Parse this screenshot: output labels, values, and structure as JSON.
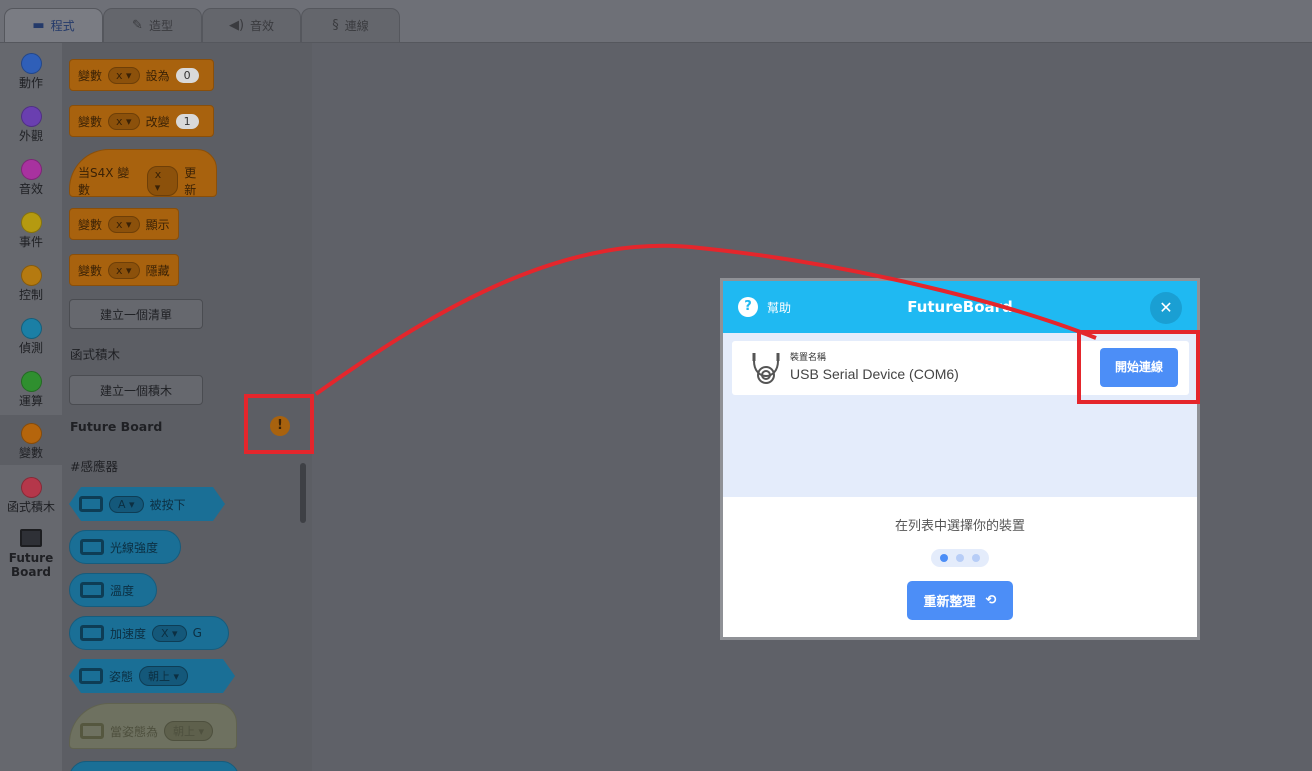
{
  "tabs": [
    {
      "label": "程式",
      "icon": "code-icon",
      "active": true
    },
    {
      "label": "造型",
      "icon": "brush-icon",
      "active": false
    },
    {
      "label": "音效",
      "icon": "speaker-icon",
      "active": false
    },
    {
      "label": "連線",
      "icon": "connection-icon",
      "active": false
    }
  ],
  "categories": [
    {
      "label": "動作",
      "color": "#2f5fb8"
    },
    {
      "label": "外觀",
      "color": "#6a3fb0"
    },
    {
      "label": "音效",
      "color": "#a8329f"
    },
    {
      "label": "事件",
      "color": "#b59a10"
    },
    {
      "label": "控制",
      "color": "#b57a10"
    },
    {
      "label": "偵測",
      "color": "#1b7fa5"
    },
    {
      "label": "運算",
      "color": "#2f8f2f"
    },
    {
      "label": "變數",
      "color": "#b5650c"
    },
    {
      "label": "函式積木",
      "color": "#b5374a"
    },
    {
      "label": "Future\nBoard",
      "color": "#1c1d20"
    }
  ],
  "palette": {
    "set_block": {
      "label": "變數",
      "var": "x",
      "verb": "設為",
      "value": "0"
    },
    "change_block": {
      "label": "變數",
      "var": "x",
      "verb": "改變",
      "value": "1"
    },
    "when_block": {
      "label": "当S4X 變數",
      "var": "x",
      "verb": "更新"
    },
    "show_block": {
      "label": "變數",
      "var": "x",
      "verb": "顯示"
    },
    "hide_block": {
      "label": "變數",
      "var": "x",
      "verb": "隱藏"
    },
    "make_list": "建立一個清單",
    "func_heading": "函式積木",
    "make_block": "建立一個積木",
    "fb_heading": "Future Board",
    "sensor_heading": "#感應器",
    "sensor_blocks": {
      "pressed": {
        "key": "A",
        "text": "被按下"
      },
      "light": "光線強度",
      "temp": "溫度",
      "accel": {
        "text": "加速度",
        "axis": "X",
        "unit": "G"
      },
      "pose": {
        "text": "姿態",
        "value": "朝上"
      },
      "when_pose": {
        "text": "當姿態為",
        "value": "朝上"
      }
    }
  },
  "modal": {
    "help": "幫助",
    "title": "FutureBoard",
    "device_label": "裝置名稱",
    "device_name": "USB Serial Device (COM6)",
    "connect": "開始連線",
    "choose": "在列表中選擇你的裝置",
    "refresh": "重新整理"
  },
  "colors": {
    "header": "#1fb9f2",
    "button": "#4c8ef7",
    "highlight": "#e4262c"
  }
}
